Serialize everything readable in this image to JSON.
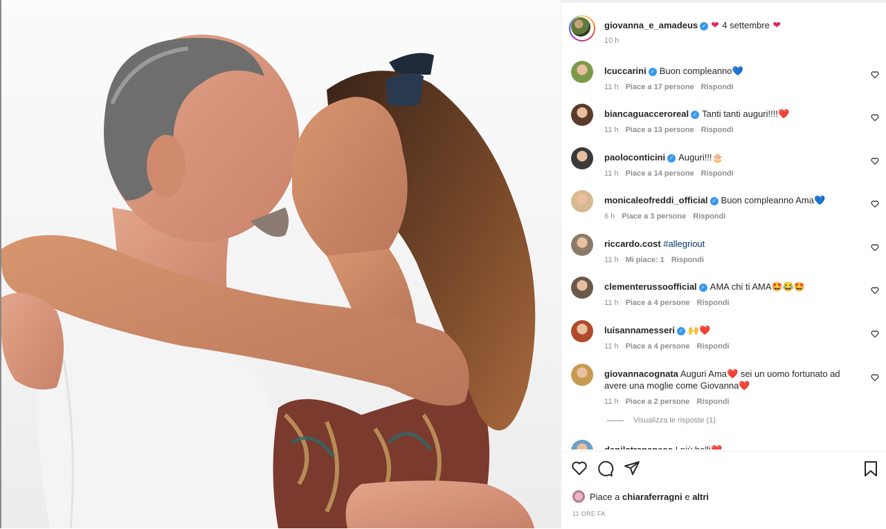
{
  "post": {
    "author": "giovanna_e_amadeus",
    "caption_text": "4 settembre",
    "time": "10 h"
  },
  "comments": [
    {
      "user": "lcuccarini",
      "verified": true,
      "text": "Buon compleanno",
      "emoji": "💙",
      "time": "11 h",
      "likes": "Piace a 17 persone",
      "reply": "Rispondi",
      "avatar_color": "#7a9a4a"
    },
    {
      "user": "biancaguaccero real",
      "display_user": "biancaguacceroreal",
      "verified": true,
      "text": "Tanti tanti auguri!!!!",
      "emoji": "❤️",
      "time": "11 h",
      "likes": "Piace a 13 persone",
      "reply": "Rispondi",
      "avatar_color": "#5a3a2a"
    },
    {
      "user": "paoloconticini",
      "verified": true,
      "text": "Auguri!!!",
      "emoji": "🎂",
      "time": "11 h",
      "likes": "Piace a 14 persone",
      "reply": "Rispondi",
      "avatar_color": "#3a3a3a"
    },
    {
      "user": "monicaleofreddi_official",
      "verified": true,
      "text": "Buon compleanno Ama",
      "emoji": "💙",
      "time": "6 h",
      "likes": "Piace a 3 persone",
      "reply": "Rispondi",
      "avatar_color": "#d8b890"
    },
    {
      "user": "riccardo.cost",
      "verified": false,
      "text": "#allegriout",
      "emoji": "",
      "time": "11 h",
      "likes": "Mi piace: 1",
      "reply": "Rispondi",
      "avatar_color": "#8a7a6a"
    },
    {
      "user": "clementerussoofficial",
      "verified": true,
      "text": "AMA chi ti AMA",
      "emoji": "🤩😂🤩",
      "time": "11 h",
      "likes": "Piace a 4 persone",
      "reply": "Rispondi",
      "avatar_color": "#6a5a4a"
    },
    {
      "user": "luisannamesseri",
      "verified": true,
      "text": "",
      "emoji": "🙌❤️",
      "time": "11 h",
      "likes": "Piace a 4 persone",
      "reply": "Rispondi",
      "avatar_color": "#b04a2a"
    },
    {
      "user": "giovannacognata",
      "verified": false,
      "text": "Auguri Ama❤️ sei un uomo fortunato ad avere una moglie come Giovanna",
      "emoji": "❤️",
      "time": "11 h",
      "likes": "Piace a 2 persone",
      "reply": "Rispondi",
      "avatar_color": "#c89a50"
    },
    {
      "user": "danilatrapanese",
      "verified": false,
      "text": "I più belli",
      "emoji": "❤️",
      "time": "",
      "likes": "",
      "reply": "",
      "avatar_color": "#6aa0c8"
    }
  ],
  "view_replies": "Visualizza le risposte (1)",
  "footer": {
    "likes_prefix": "Piace a",
    "likes_user": "chiaraferragni",
    "likes_joiner": "e",
    "likes_others": "altri",
    "timestamp": "11 ORE FA"
  },
  "colors": {
    "verified": "#3897f0",
    "heart": "#e0245e",
    "meta_grey": "#8e8e8e",
    "text": "#262626"
  }
}
